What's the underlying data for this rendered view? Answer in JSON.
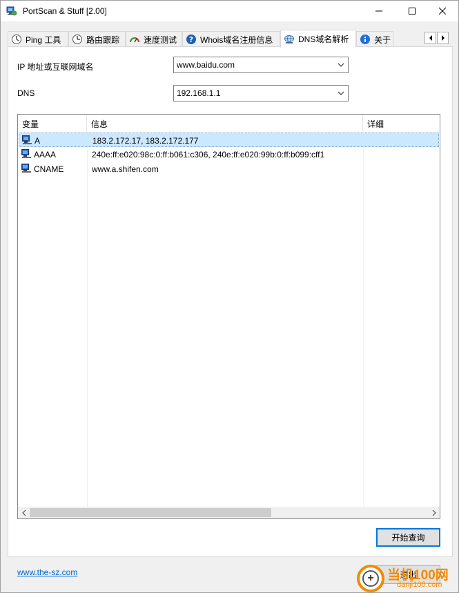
{
  "window": {
    "title": "PortScan & Stuff [2.00]"
  },
  "tabs": [
    {
      "label": "Ping 工具",
      "icon": "ping-icon"
    },
    {
      "label": "路由跟踪",
      "icon": "traceroute-icon"
    },
    {
      "label": "速度测试",
      "icon": "speedometer-icon"
    },
    {
      "label": "Whois域名注册信息",
      "icon": "help-icon"
    },
    {
      "label": "DNS域名解析",
      "icon": "network-globe-icon"
    },
    {
      "label": "关于",
      "icon": "info-icon"
    }
  ],
  "active_tab": "DNS域名解析",
  "form": {
    "host_label": "IP 地址或互联网域名",
    "host_value": "www.baidu.com",
    "dns_label": "DNS",
    "dns_value": "192.168.1.1"
  },
  "results": {
    "columns": [
      "变量",
      "信息",
      "详细"
    ],
    "rows": [
      {
        "type": "A",
        "info": "183.2.172.17, 183.2.172.177",
        "detail": ""
      },
      {
        "type": "AAAA",
        "info": "240e:ff:e020:98c:0:ff:b061:c306, 240e:ff:e020:99b:0:ff:b099:cff1",
        "detail": ""
      },
      {
        "type": "CNAME",
        "info": "www.a.shifen.com",
        "detail": ""
      }
    ]
  },
  "buttons": {
    "start_query": "开始查询",
    "exit": "退出"
  },
  "footer": {
    "link": "www.the-sz.com"
  },
  "watermark": {
    "brand": "当机100网",
    "domain": "danji100.com"
  }
}
